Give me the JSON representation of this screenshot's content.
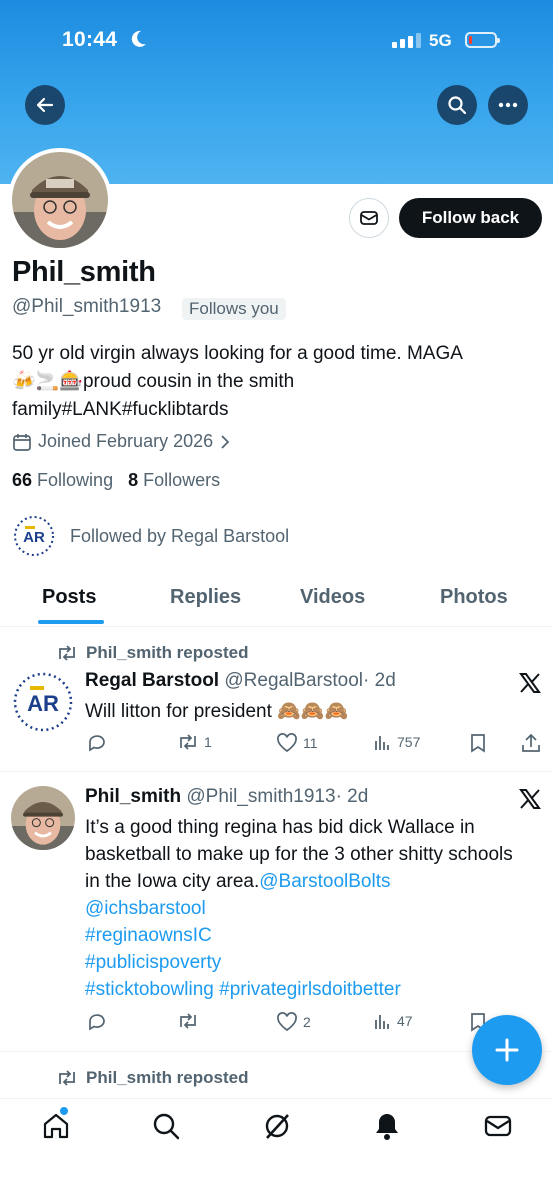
{
  "status_bar": {
    "time": "10:44",
    "network": "5G"
  },
  "profile": {
    "name": "Phil_smith",
    "handle": "@Phil_smith1913",
    "follows_you": "Follows you",
    "follow_button": "Follow back",
    "bio_line1": "50 yr old virgin always looking for a good time. MAGA",
    "bio_line2_emoji": "🍻🚬🎰",
    "bio_line2_text": "proud cousin in the smith",
    "bio_line3": "family#LANK#fucklibtards",
    "joined": "Joined February 2026",
    "following_count": "66",
    "following_label": "Following",
    "followers_count": "8",
    "followers_label": "Followers",
    "followed_by": "Followed by Regal Barstool"
  },
  "tabs": [
    "Posts",
    "Replies",
    "Videos",
    "Photos"
  ],
  "posts": [
    {
      "repost_label": "Phil_smith reposted",
      "author": "Regal Barstool",
      "handle": "@RegalBarstool",
      "time": "· 2d",
      "text": "Will litton for president",
      "emoji": "🙈🙈🙈",
      "replies": "",
      "reposts": "1",
      "likes": "11",
      "views": "757"
    },
    {
      "author": "Phil_smith",
      "handle": "@Phil_smith1913",
      "time": "· 2d",
      "text_plain": "It’s a good thing regina has bid dick Wallace in basketball to make up for the 3 other shitty schools in the Iowa city area.",
      "mention1": "@BarstoolBolts",
      "mention2": "@ichsbarstool",
      "hashtag1": "#reginaownsIC",
      "hashtag2": "#publicispoverty",
      "hashtag3": "#sticktobowling",
      "hashtag4": "#privategirlsdoitbetter",
      "replies": "",
      "reposts": "",
      "likes": "2",
      "views": "47"
    },
    {
      "repost_label": "Phil_smith reposted"
    }
  ],
  "colors": {
    "accent": "#1d9bf0",
    "banner": "#2a9ae6",
    "text": "#0f1419",
    "muted": "#536471"
  }
}
